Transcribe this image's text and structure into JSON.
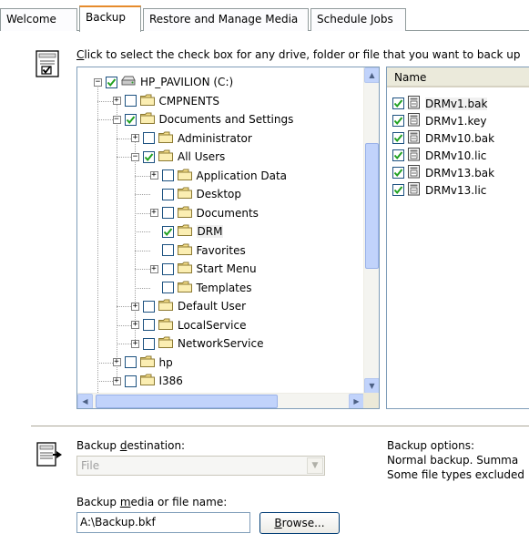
{
  "tabs": [
    "Welcome",
    "Backup",
    "Restore and Manage Media",
    "Schedule Jobs"
  ],
  "instruction": {
    "accel": "C",
    "rest": "lick to select the check box for any drive, folder or file that you want to back up"
  },
  "tree": [
    {
      "label": "HP_PAVILION (C:)",
      "checked": true,
      "expander": "minus",
      "icon": "drive-icon"
    },
    {
      "label": "CMPNENTS",
      "checked": false,
      "expander": "plus",
      "icon": "folder-icon"
    },
    {
      "label": "Documents and Settings",
      "checked": true,
      "expander": "minus",
      "icon": "folder-icon"
    },
    {
      "label": "Administrator",
      "checked": false,
      "expander": "plus",
      "icon": "folder-icon"
    },
    {
      "label": "All Users",
      "checked": true,
      "expander": "minus",
      "icon": "folder-icon"
    },
    {
      "label": "Application Data",
      "checked": false,
      "expander": "plus",
      "icon": "folder-icon"
    },
    {
      "label": "Desktop",
      "checked": false,
      "expander": "none",
      "icon": "folder-icon"
    },
    {
      "label": "Documents",
      "checked": false,
      "expander": "plus",
      "icon": "folder-icon"
    },
    {
      "label": "DRM",
      "checked": true,
      "expander": "none",
      "icon": "folder-icon",
      "selected": true
    },
    {
      "label": "Favorites",
      "checked": false,
      "expander": "none",
      "icon": "folder-icon"
    },
    {
      "label": "Start Menu",
      "checked": false,
      "expander": "plus",
      "icon": "folder-icon"
    },
    {
      "label": "Templates",
      "checked": false,
      "expander": "none",
      "icon": "folder-icon"
    },
    {
      "label": "Default User",
      "checked": false,
      "expander": "plus",
      "icon": "folder-icon"
    },
    {
      "label": "LocalService",
      "checked": false,
      "expander": "plus",
      "icon": "folder-icon"
    },
    {
      "label": "NetworkService",
      "checked": false,
      "expander": "plus",
      "icon": "folder-icon"
    },
    {
      "label": "hp",
      "checked": false,
      "expander": "plus",
      "icon": "folder-icon"
    },
    {
      "label": "I386",
      "checked": false,
      "expander": "plus",
      "icon": "folder-icon"
    }
  ],
  "list": {
    "header": "Name",
    "files": [
      {
        "label": "DRMv1.bak",
        "checked": true
      },
      {
        "label": "DRMv1.key",
        "checked": true
      },
      {
        "label": "DRMv10.bak",
        "checked": true
      },
      {
        "label": "DRMv10.lic",
        "checked": true
      },
      {
        "label": "DRMv13.bak",
        "checked": true
      },
      {
        "label": "DRMv13.lic",
        "checked": true
      }
    ]
  },
  "bottom": {
    "dest_label_pre": "Backup ",
    "dest_label_accel": "d",
    "dest_label_post": "estination:",
    "dest_value": "File",
    "media_label_pre": "Backup ",
    "media_label_accel": "m",
    "media_label_post": "edia or file name:",
    "media_value": "A:\\Backup.bkf",
    "browse_accel": "B",
    "browse_rest": "rowse...",
    "options_label": "Backup options:",
    "options_line1": "Normal backup.  Summa",
    "options_line2": "Some file types excluded"
  },
  "colors": {
    "active_tab_accent": "#e68b2c",
    "pane_border": "#7f9db9",
    "checkbox_border": "#1c5180",
    "checkmark": "#21a121",
    "folder_fill": "#f7e08a"
  }
}
